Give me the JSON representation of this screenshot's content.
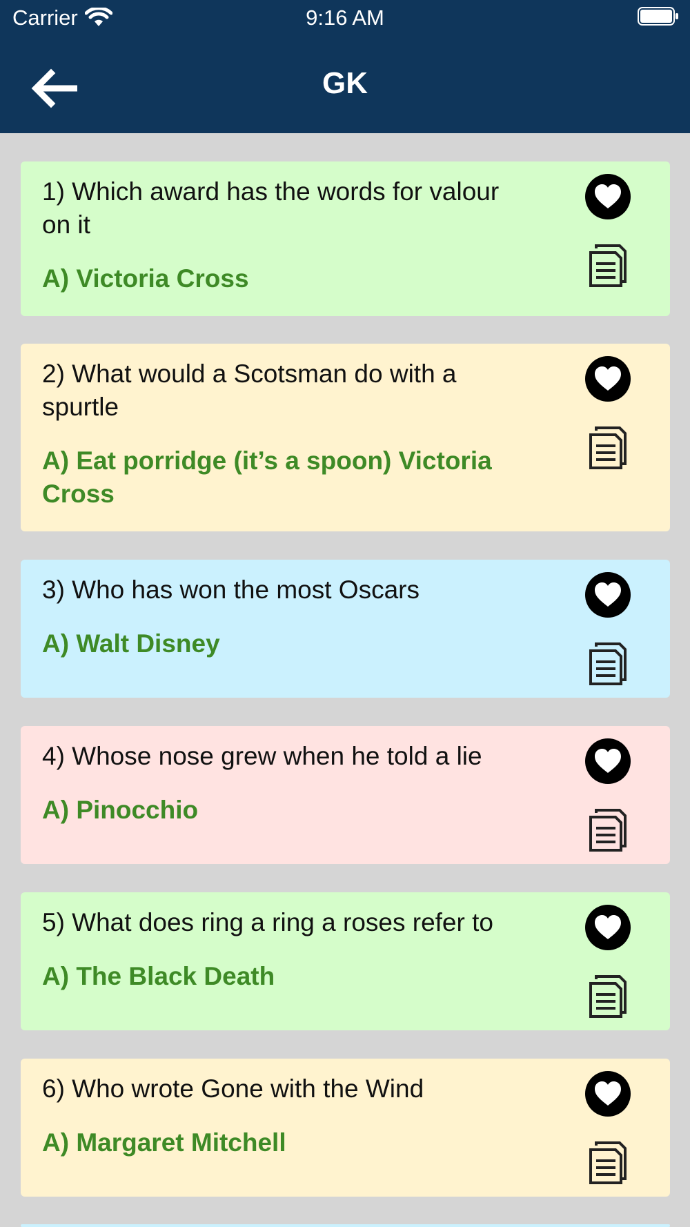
{
  "status_bar": {
    "carrier": "Carrier",
    "time": "9:16 AM"
  },
  "header": {
    "title": "GK",
    "back_icon": "arrow-left-icon"
  },
  "colors": {
    "header_bg": "#0f365b",
    "page_bg": "#d5d5d5",
    "answer_text": "#3e8a26",
    "card_green": "#d5fdca",
    "card_yellow": "#fff3cf",
    "card_blue": "#cbf1fe",
    "card_pink": "#ffe3e1"
  },
  "cards": [
    {
      "question": "1) Which award has the words for valour on it",
      "answer": "A) Victoria Cross",
      "color": "#d5fdca",
      "favorite_icon": "heart-icon",
      "copy_icon": "copy-icon"
    },
    {
      "question": "2) What would a Scotsman do with a spurtle",
      "answer": "A) Eat porridge (it’s a spoon) Victoria Cross",
      "color": "#fff3cf",
      "favorite_icon": "heart-icon",
      "copy_icon": "copy-icon"
    },
    {
      "question": "3) Who has won the most Oscars",
      "answer": "A) Walt Disney",
      "color": "#cbf1fe",
      "favorite_icon": "heart-icon",
      "copy_icon": "copy-icon"
    },
    {
      "question": "4) Whose nose grew when he told a lie",
      "answer": "A) Pinocchio",
      "color": "#ffe3e1",
      "favorite_icon": "heart-icon",
      "copy_icon": "copy-icon"
    },
    {
      "question": "5) What does ring a ring a roses refer to",
      "answer": "A) The Black Death",
      "color": "#d5fdca",
      "favorite_icon": "heart-icon",
      "copy_icon": "copy-icon"
    },
    {
      "question": "6) Who wrote Gone with the Wind",
      "answer": "A) Margaret Mitchell",
      "color": "#fff3cf",
      "favorite_icon": "heart-icon",
      "copy_icon": "copy-icon"
    }
  ]
}
